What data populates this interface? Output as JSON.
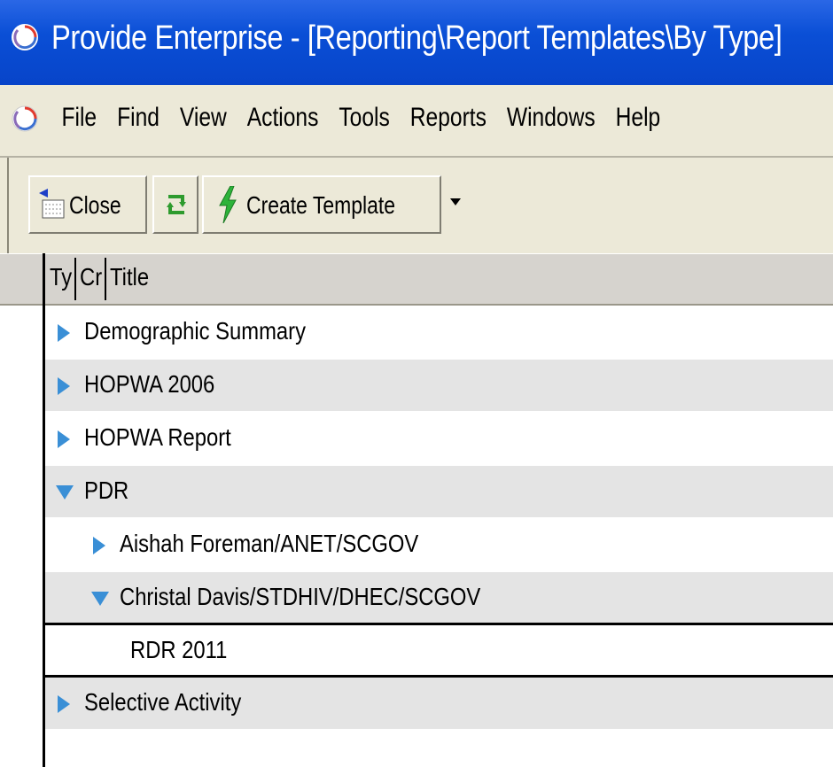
{
  "window": {
    "title": "Provide Enterprise - [Reporting\\Report Templates\\By Type]",
    "icon": "provide-app-icon"
  },
  "menu": {
    "items": [
      "File",
      "Find",
      "View",
      "Actions",
      "Tools",
      "Reports",
      "Windows",
      "Help"
    ]
  },
  "toolbar": {
    "close_label": "Close",
    "refresh_icon": "refresh-icon",
    "create_label": "Create Template",
    "dropdown_icon": "chevron-down-icon"
  },
  "columns": [
    "Ty",
    "Cr",
    "Title"
  ],
  "rows": [
    {
      "label": "Demographic Summary",
      "state": "collapsed",
      "level": 0
    },
    {
      "label": "HOPWA 2006",
      "state": "collapsed",
      "level": 0
    },
    {
      "label": "HOPWA Report",
      "state": "collapsed",
      "level": 0
    },
    {
      "label": "PDR",
      "state": "expanded",
      "level": 0
    },
    {
      "label": "Aishah Foreman/ANET/SCGOV",
      "state": "collapsed",
      "level": 1
    },
    {
      "label": "Christal Davis/STDHIV/DHEC/SCGOV",
      "state": "expanded",
      "level": 1
    },
    {
      "label": "RDR 2011",
      "state": "leaf",
      "level": 2
    },
    {
      "label": "Selective Activity",
      "state": "collapsed",
      "level": 0
    }
  ],
  "colors": {
    "titlebar": "#0a4fd6",
    "chrome": "#ece9d8",
    "row_shade": "#e4e4e4",
    "twisty": "#3a8fd6"
  }
}
